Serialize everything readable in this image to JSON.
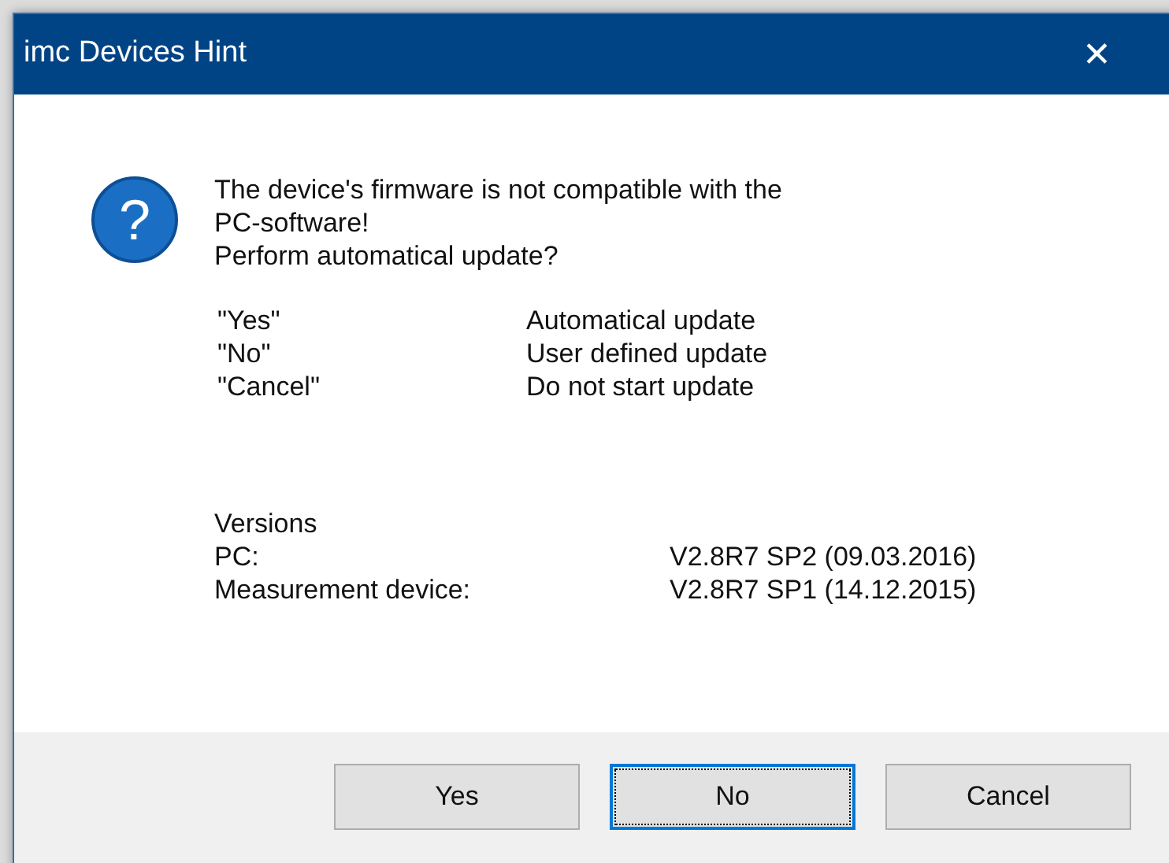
{
  "window": {
    "title": "imc Devices Hint",
    "close": "✕"
  },
  "message": {
    "icon": "?",
    "lines": [
      "The device's firmware is not compatible with the",
      "PC-software!",
      "Perform automatical update?"
    ]
  },
  "options": [
    {
      "key": "\"Yes\"",
      "description": "Automatical update"
    },
    {
      "key": "\"No\"",
      "description": "User defined update"
    },
    {
      "key": "\"Cancel\"",
      "description": "Do not start update"
    }
  ],
  "versions": {
    "heading": "Versions",
    "rows": [
      {
        "label": "PC:",
        "value": "V2.8R7 SP2 (09.03.2016)"
      },
      {
        "label": "Measurement device:",
        "value": "V2.8R7 SP1 (14.12.2015)"
      }
    ]
  },
  "buttons": [
    {
      "label": "Yes",
      "focused": false
    },
    {
      "label": "No",
      "focused": true
    },
    {
      "label": "Cancel",
      "focused": false
    }
  ]
}
